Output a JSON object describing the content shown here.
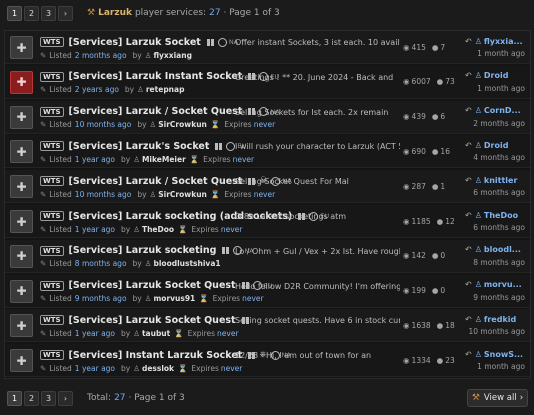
{
  "pagination": {
    "pages": [
      "1",
      "2",
      "3"
    ],
    "next": "›",
    "current": "1"
  },
  "breadcrumb": {
    "game": "Larzuk",
    "text": "player services:",
    "count": "27",
    "page_info": "· Page 1 of 3"
  },
  "labels": {
    "listed": "Listed",
    "by": "by",
    "expires": "Expires",
    "never": "never",
    "wts": "WTS"
  },
  "rows": [
    {
      "title": "[Services] Larzuk Socket",
      "region": "NA",
      "extra": "",
      "snippet": "Offer instant Sockets, 3 ist each. 10 available. Add my",
      "age": "2 months ago",
      "user": "flyxxiang",
      "views": "415",
      "replies": "7",
      "last_user": "flyxxia...",
      "last_time": "1 month ago",
      "avatar": "cross"
    },
    {
      "title": "[Services] Larzuk Instant Socket",
      "region": "EU",
      "extra": "",
      "snippet": "Greetings ! ** 20. June 2024 - Back and",
      "age": "2 years ago",
      "user": "retepnap",
      "views": "6007",
      "replies": "73",
      "last_user": "Droid",
      "last_time": "1 month ago",
      "avatar": "red"
    },
    {
      "title": "[Services] Larzuk / Socket Quest",
      "region": "NA",
      "extra": "",
      "snippet": "Selling Sockets for Ist each. 2x remain",
      "age": "10 months ago",
      "user": "SirCrowkun",
      "views": "439",
      "replies": "6",
      "last_user": "CornD...",
      "last_time": "2 months ago",
      "avatar": "cross",
      "expires": true
    },
    {
      "title": "[Services] Larzuk's Socket",
      "region": "EU",
      "extra": "",
      "snippet": "I will rush your character to Larzuk (ACT 5 N",
      "age": "1 year ago",
      "user": "MikeMeier",
      "views": "690",
      "replies": "16",
      "last_user": "Droid",
      "last_time": "4 months ago",
      "avatar": "cross",
      "expires": true
    },
    {
      "title": "[Services] Larzuk / Socket Quest",
      "region": "NA",
      "extra": "skull",
      "snippet": "Selling Socket Quest For Mal",
      "age": "10 months ago",
      "user": "SirCrowkun",
      "views": "287",
      "replies": "1",
      "last_user": "knittler",
      "last_time": "6 months ago",
      "avatar": "cross",
      "expires": true
    },
    {
      "title": "[Services] Larzuk socketing (add sockets)",
      "region": "EU",
      "extra": "",
      "snippet": "O 8x Larzuk socketings atm",
      "age": "1 year ago",
      "user": "TheDoo",
      "views": "1185",
      "replies": "12",
      "last_user": "TheDoo",
      "last_time": "6 months ago",
      "avatar": "cross",
      "expires": true
    },
    {
      "title": "[Services] Larzuk socketing",
      "region": "NA",
      "extra": "",
      "snippet": "Lo / Ohm + Gul / Vex + 2x Ist. Have roughly",
      "age": "8 months ago",
      "user": "bloodlustshiva1",
      "views": "142",
      "replies": "0",
      "last_user": "bloodl...",
      "last_time": "8 months ago",
      "avatar": "cross"
    },
    {
      "title": "[Services] Larzuk Socket Quest",
      "region": "EU",
      "extra": "",
      "snippet": "Hello fellow D2R Community! I'm offering",
      "age": "9 months ago",
      "user": "morvus91",
      "views": "199",
      "replies": "0",
      "last_user": "morvu...",
      "last_time": "9 months ago",
      "avatar": "cross",
      "expires": true
    },
    {
      "title": "[Services] Larzuk Socket Quest",
      "region": "",
      "extra": "",
      "snippet": "Selling socket quests. Have 6 in stock currently",
      "age": "1 year ago",
      "user": "taubut",
      "views": "1638",
      "replies": "18",
      "last_user": "fredkid",
      "last_time": "10 months ago",
      "avatar": "cross",
      "expires": true
    },
    {
      "title": "[Services] Instant Larzuk Socket",
      "region": "NA",
      "extra": "ps",
      "snippet": "12/28 - Hi, I am out of town for an",
      "age": "1 year ago",
      "user": "desslok",
      "views": "1334",
      "replies": "23",
      "last_user": "SnowS...",
      "last_time": "1 month ago",
      "avatar": "cross",
      "expires": true
    }
  ],
  "footer": {
    "total_label": "Total:",
    "total": "27",
    "page_info": "· Page 1 of 3",
    "view_all": "View all",
    "view_all_arrow": "›"
  }
}
